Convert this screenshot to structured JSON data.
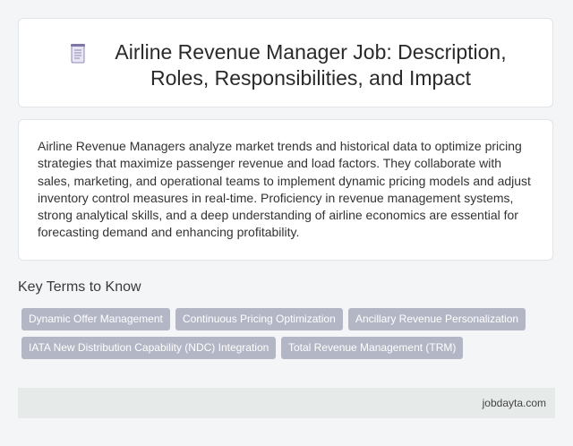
{
  "header": {
    "icon": "document-icon",
    "title": "Airline Revenue Manager Job: Description, Roles, Responsibilities, and Impact"
  },
  "description": {
    "text": "Airline Revenue Managers analyze market trends and historical data to optimize pricing strategies that maximize passenger revenue and load factors. They collaborate with sales, marketing, and operational teams to implement dynamic pricing models and adjust inventory control measures in real-time. Proficiency in revenue management systems, strong analytical skills, and a deep understanding of airline economics are essential for forecasting demand and enhancing profitability."
  },
  "key_terms": {
    "heading": "Key Terms to Know",
    "tags": [
      "Dynamic Offer Management",
      "Continuous Pricing Optimization",
      "Ancillary Revenue Personalization",
      "IATA New Distribution Capability (NDC) Integration",
      "Total Revenue Management (TRM)"
    ]
  },
  "footer": {
    "site": "jobdayta.com"
  },
  "colors": {
    "background": "#f4f5f7",
    "card": "#ffffff",
    "tag": "#b3b6c5",
    "footer": "#e6ebea"
  }
}
